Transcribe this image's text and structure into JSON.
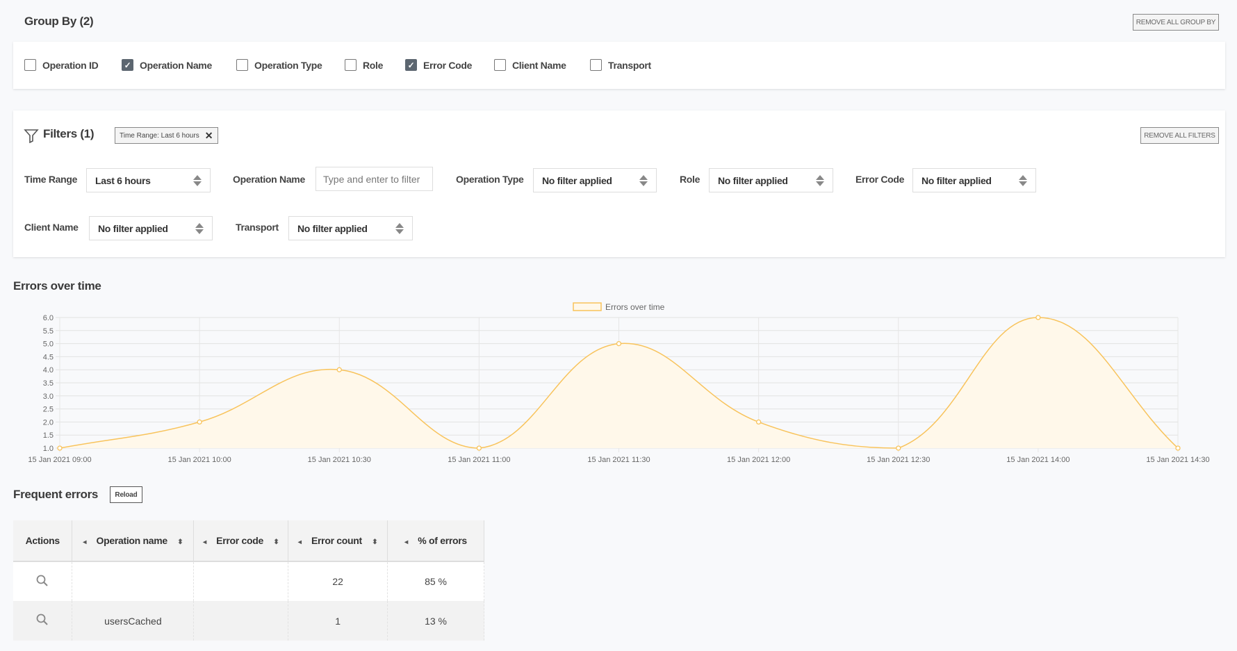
{
  "group_by": {
    "title": "Group By (2)",
    "remove_all_label": "REMOVE ALL GROUP BY",
    "options": [
      {
        "label": "Operation ID",
        "checked": false
      },
      {
        "label": "Operation Name",
        "checked": true
      },
      {
        "label": "Operation Type",
        "checked": false
      },
      {
        "label": "Role",
        "checked": false
      },
      {
        "label": "Error Code",
        "checked": true
      },
      {
        "label": "Client Name",
        "checked": false
      },
      {
        "label": "Transport",
        "checked": false
      }
    ]
  },
  "filters": {
    "title": "Filters (1)",
    "chip_label": "Time Range: Last 6 hours",
    "remove_all_label": "REMOVE ALL FILTERS",
    "time_range": {
      "label": "Time Range",
      "value": "Last 6 hours"
    },
    "operation_name": {
      "label": "Operation Name",
      "placeholder": "Type and enter to filter"
    },
    "operation_type": {
      "label": "Operation Type",
      "value": "No filter applied"
    },
    "role": {
      "label": "Role",
      "value": "No filter applied"
    },
    "error_code": {
      "label": "Error Code",
      "value": "No filter applied"
    },
    "client_name": {
      "label": "Client Name",
      "value": "No filter applied"
    },
    "transport": {
      "label": "Transport",
      "value": "No filter applied"
    }
  },
  "chart_section": {
    "title": "Errors over time"
  },
  "chart_data": {
    "type": "area",
    "legend": "Errors over time",
    "legend_position": "top",
    "categories": [
      "15 Jan 2021 09:00",
      "15 Jan 2021 10:00",
      "15 Jan 2021 10:30",
      "15 Jan 2021 11:00",
      "15 Jan 2021 11:30",
      "15 Jan 2021 12:00",
      "15 Jan 2021 12:30",
      "15 Jan 2021 14:00",
      "15 Jan 2021 14:30"
    ],
    "series": [
      {
        "name": "Errors over time",
        "values": [
          1,
          2,
          4,
          1,
          5,
          2,
          1,
          6,
          1
        ]
      }
    ],
    "ylim": [
      1.0,
      6.0
    ],
    "yticks": [
      "1.0",
      "1.5",
      "2.0",
      "2.5",
      "3.0",
      "3.5",
      "4.0",
      "4.5",
      "5.0",
      "5.5",
      "6.0"
    ],
    "grid": true,
    "line_color": "#f8c35b",
    "fill_color": "#fff8ea"
  },
  "frequent_errors": {
    "title": "Frequent errors",
    "reload_label": "Reload",
    "columns": [
      "Actions",
      "Operation name",
      "Error code",
      "Error count",
      "% of errors"
    ],
    "rows": [
      {
        "operation_name": "",
        "error_code": "",
        "error_count": "22",
        "percent": "85 %"
      },
      {
        "operation_name": "usersCached",
        "error_code": "",
        "error_count": "1",
        "percent": "13 %"
      }
    ]
  }
}
